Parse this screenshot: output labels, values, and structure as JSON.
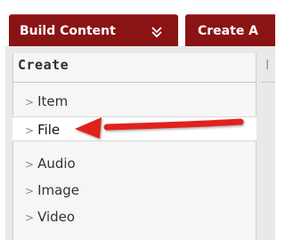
{
  "toolbar": {
    "build_label": "Build Content",
    "create_label": "Create A"
  },
  "menu": {
    "header": "Create",
    "side_header_fragment": "I",
    "items": [
      {
        "label": "Item",
        "marker": ">"
      },
      {
        "label": "File",
        "marker": ">"
      },
      {
        "label": "Audio",
        "marker": ">"
      },
      {
        "label": "Image",
        "marker": ">"
      },
      {
        "label": "Video",
        "marker": ">"
      }
    ]
  },
  "colors": {
    "toolbar_bg": "#8a1414",
    "annotation_arrow": "#e0231e"
  },
  "icons": {
    "dropdown": "double-chevron-down-icon",
    "annotation": "red-arrow-icon"
  }
}
